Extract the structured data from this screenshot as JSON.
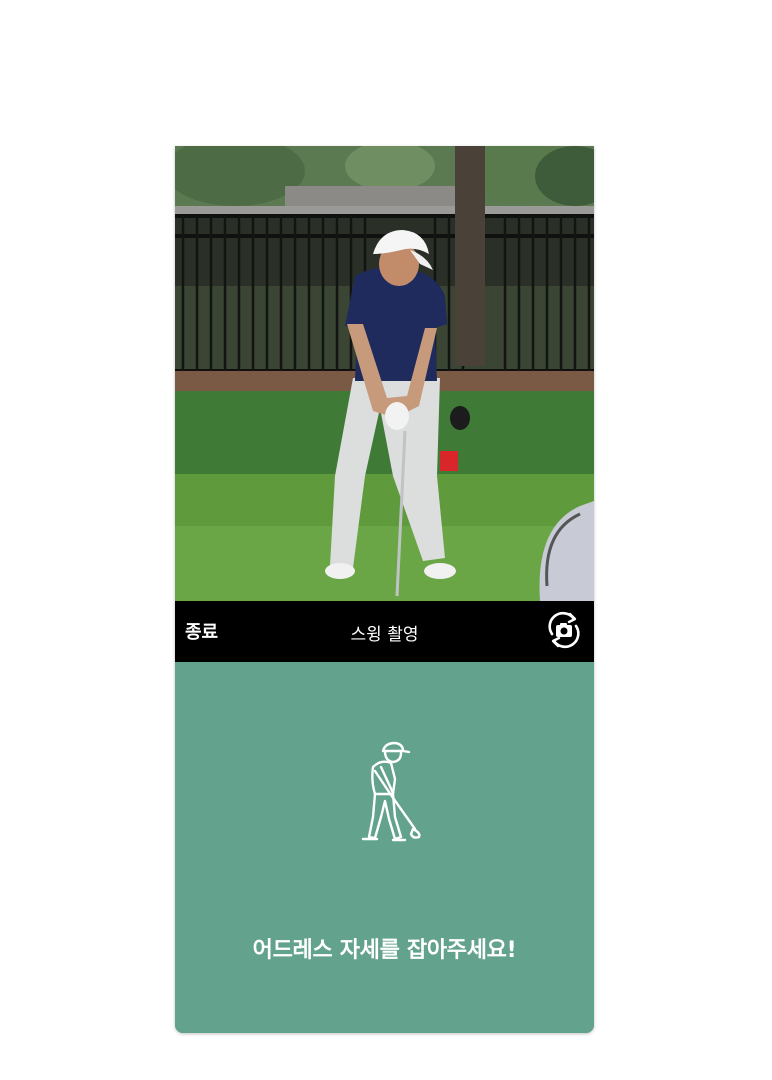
{
  "toolbar": {
    "end_label": "종료",
    "title": "스윙 촬영",
    "flip_icon": "camera-switch-icon"
  },
  "guide": {
    "icon": "golfer-address-icon",
    "message": "어드레스 자세를 잡아주세요!"
  },
  "colors": {
    "panel_bg": "#63a28d",
    "toolbar_bg": "#000000",
    "text": "#ffffff"
  }
}
